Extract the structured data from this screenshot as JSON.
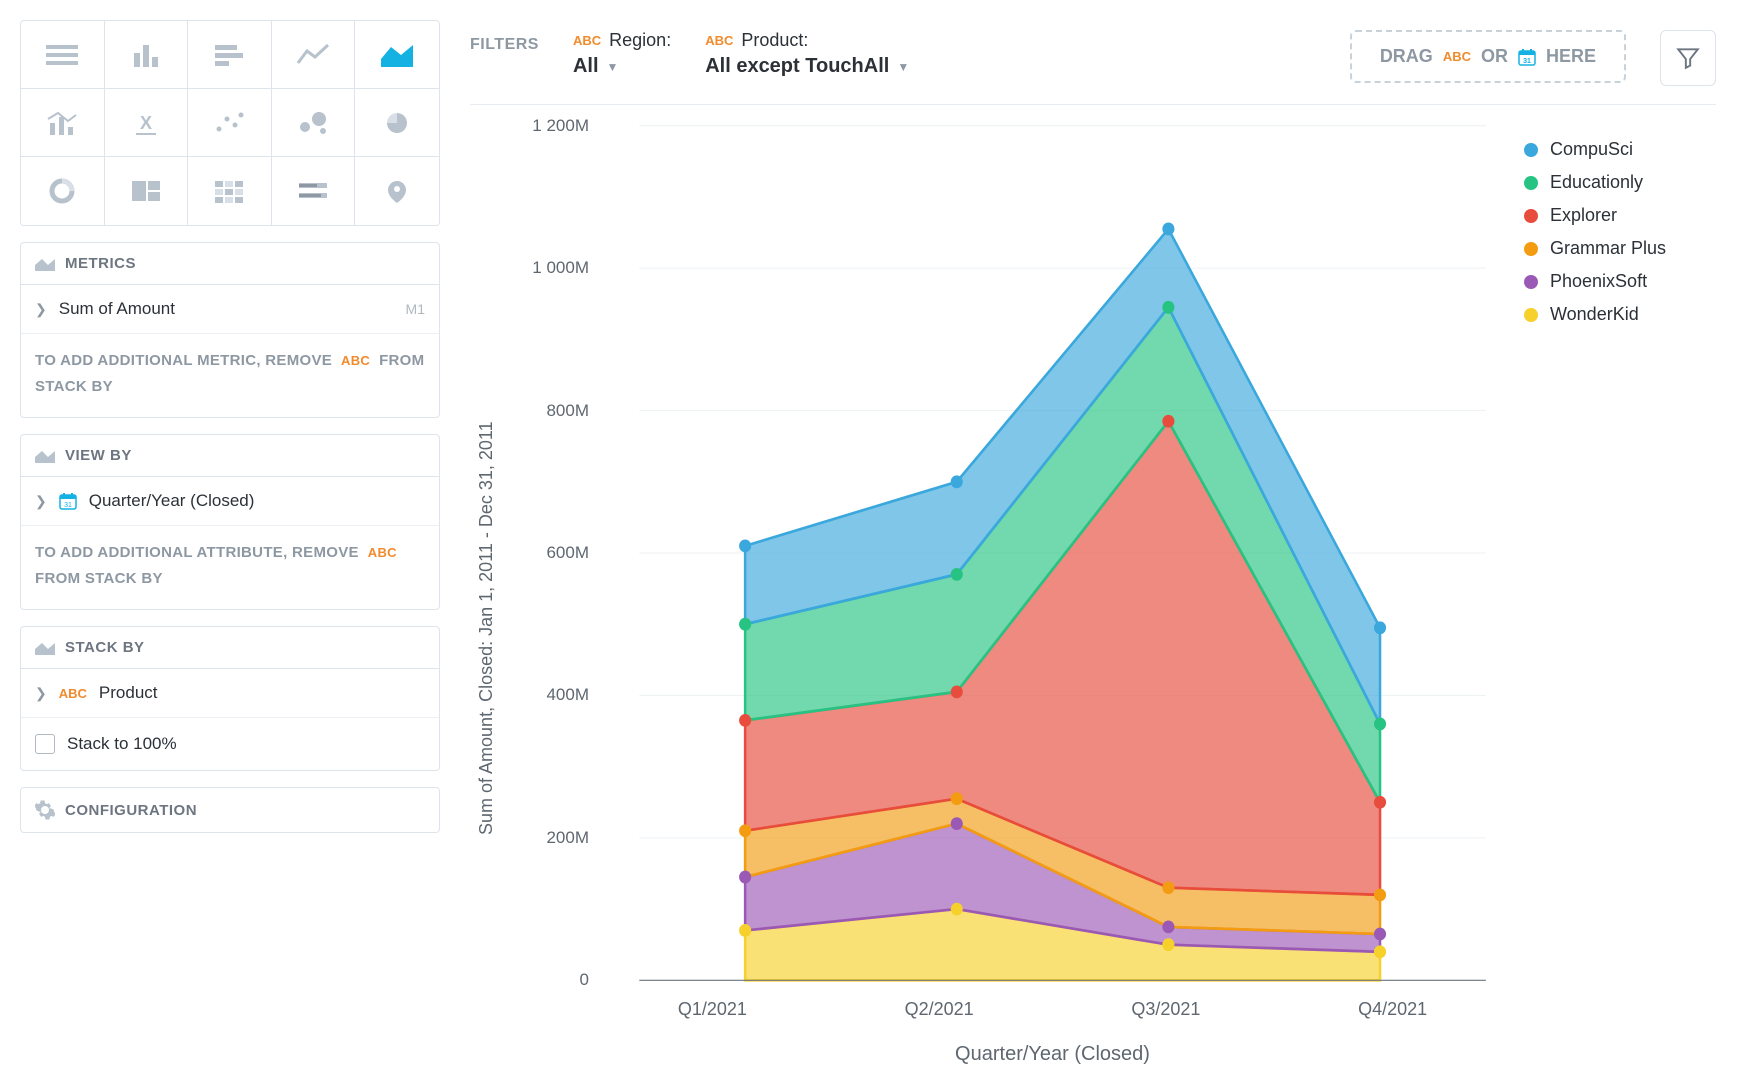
{
  "sidebar": {
    "metrics_header": "METRICS",
    "metric_item": "Sum of Amount",
    "metric_tag": "M1",
    "metric_hint_1": "TO ADD ADDITIONAL METRIC, REMOVE",
    "metric_hint_2": "FROM STACK BY",
    "viewby_header": "VIEW BY",
    "viewby_item": "Quarter/Year (Closed)",
    "viewby_hint_1": "TO ADD ADDITIONAL ATTRIBUTE, REMOVE",
    "viewby_hint_2": "FROM STACK BY",
    "stackby_header": "STACK BY",
    "stackby_item": "Product",
    "stack_to_100": "Stack to 100%",
    "config_header": "CONFIGURATION",
    "abc": "ABC"
  },
  "filters": {
    "label": "FILTERS",
    "region_name": "Region:",
    "region_value": "All",
    "product_name": "Product:",
    "product_value": "All except TouchAll",
    "drop_drag": "DRAG",
    "drop_or": "OR",
    "drop_here": "HERE",
    "abc": "ABC"
  },
  "chart_data": {
    "type": "area",
    "stacked": true,
    "categories": [
      "Q1/2021",
      "Q2/2021",
      "Q3/2021",
      "Q4/2021"
    ],
    "series": [
      {
        "name": "WonderKid",
        "color": "#f6d12b",
        "values": [
          70,
          100,
          50,
          40
        ]
      },
      {
        "name": "PhoenixSoft",
        "color": "#9b59b6",
        "values": [
          75,
          120,
          25,
          25
        ]
      },
      {
        "name": "Grammar Plus",
        "color": "#f39c12",
        "values": [
          65,
          35,
          55,
          55
        ]
      },
      {
        "name": "Explorer",
        "color": "#e74c3c",
        "values": [
          155,
          150,
          655,
          130
        ]
      },
      {
        "name": "Educationly",
        "color": "#27c383",
        "values": [
          135,
          165,
          160,
          110
        ]
      },
      {
        "name": "CompuSci",
        "color": "#3aa7dd",
        "values": [
          110,
          130,
          110,
          135
        ]
      }
    ],
    "legend_order": [
      "CompuSci",
      "Educationly",
      "Explorer",
      "Grammar Plus",
      "PhoenixSoft",
      "WonderKid"
    ],
    "ylabel": "Sum of Amount, Closed: Jan 1, 2011 - Dec 31, 2011",
    "xlabel": "Quarter/Year (Closed)",
    "ylim": [
      0,
      1200
    ],
    "yticks": [
      0,
      200,
      400,
      600,
      800,
      1000,
      1200
    ],
    "ytick_labels": [
      "0",
      "200M",
      "400M",
      "600M",
      "800M",
      "1 000M",
      "1 200M"
    ],
    "y_unit": "M"
  }
}
